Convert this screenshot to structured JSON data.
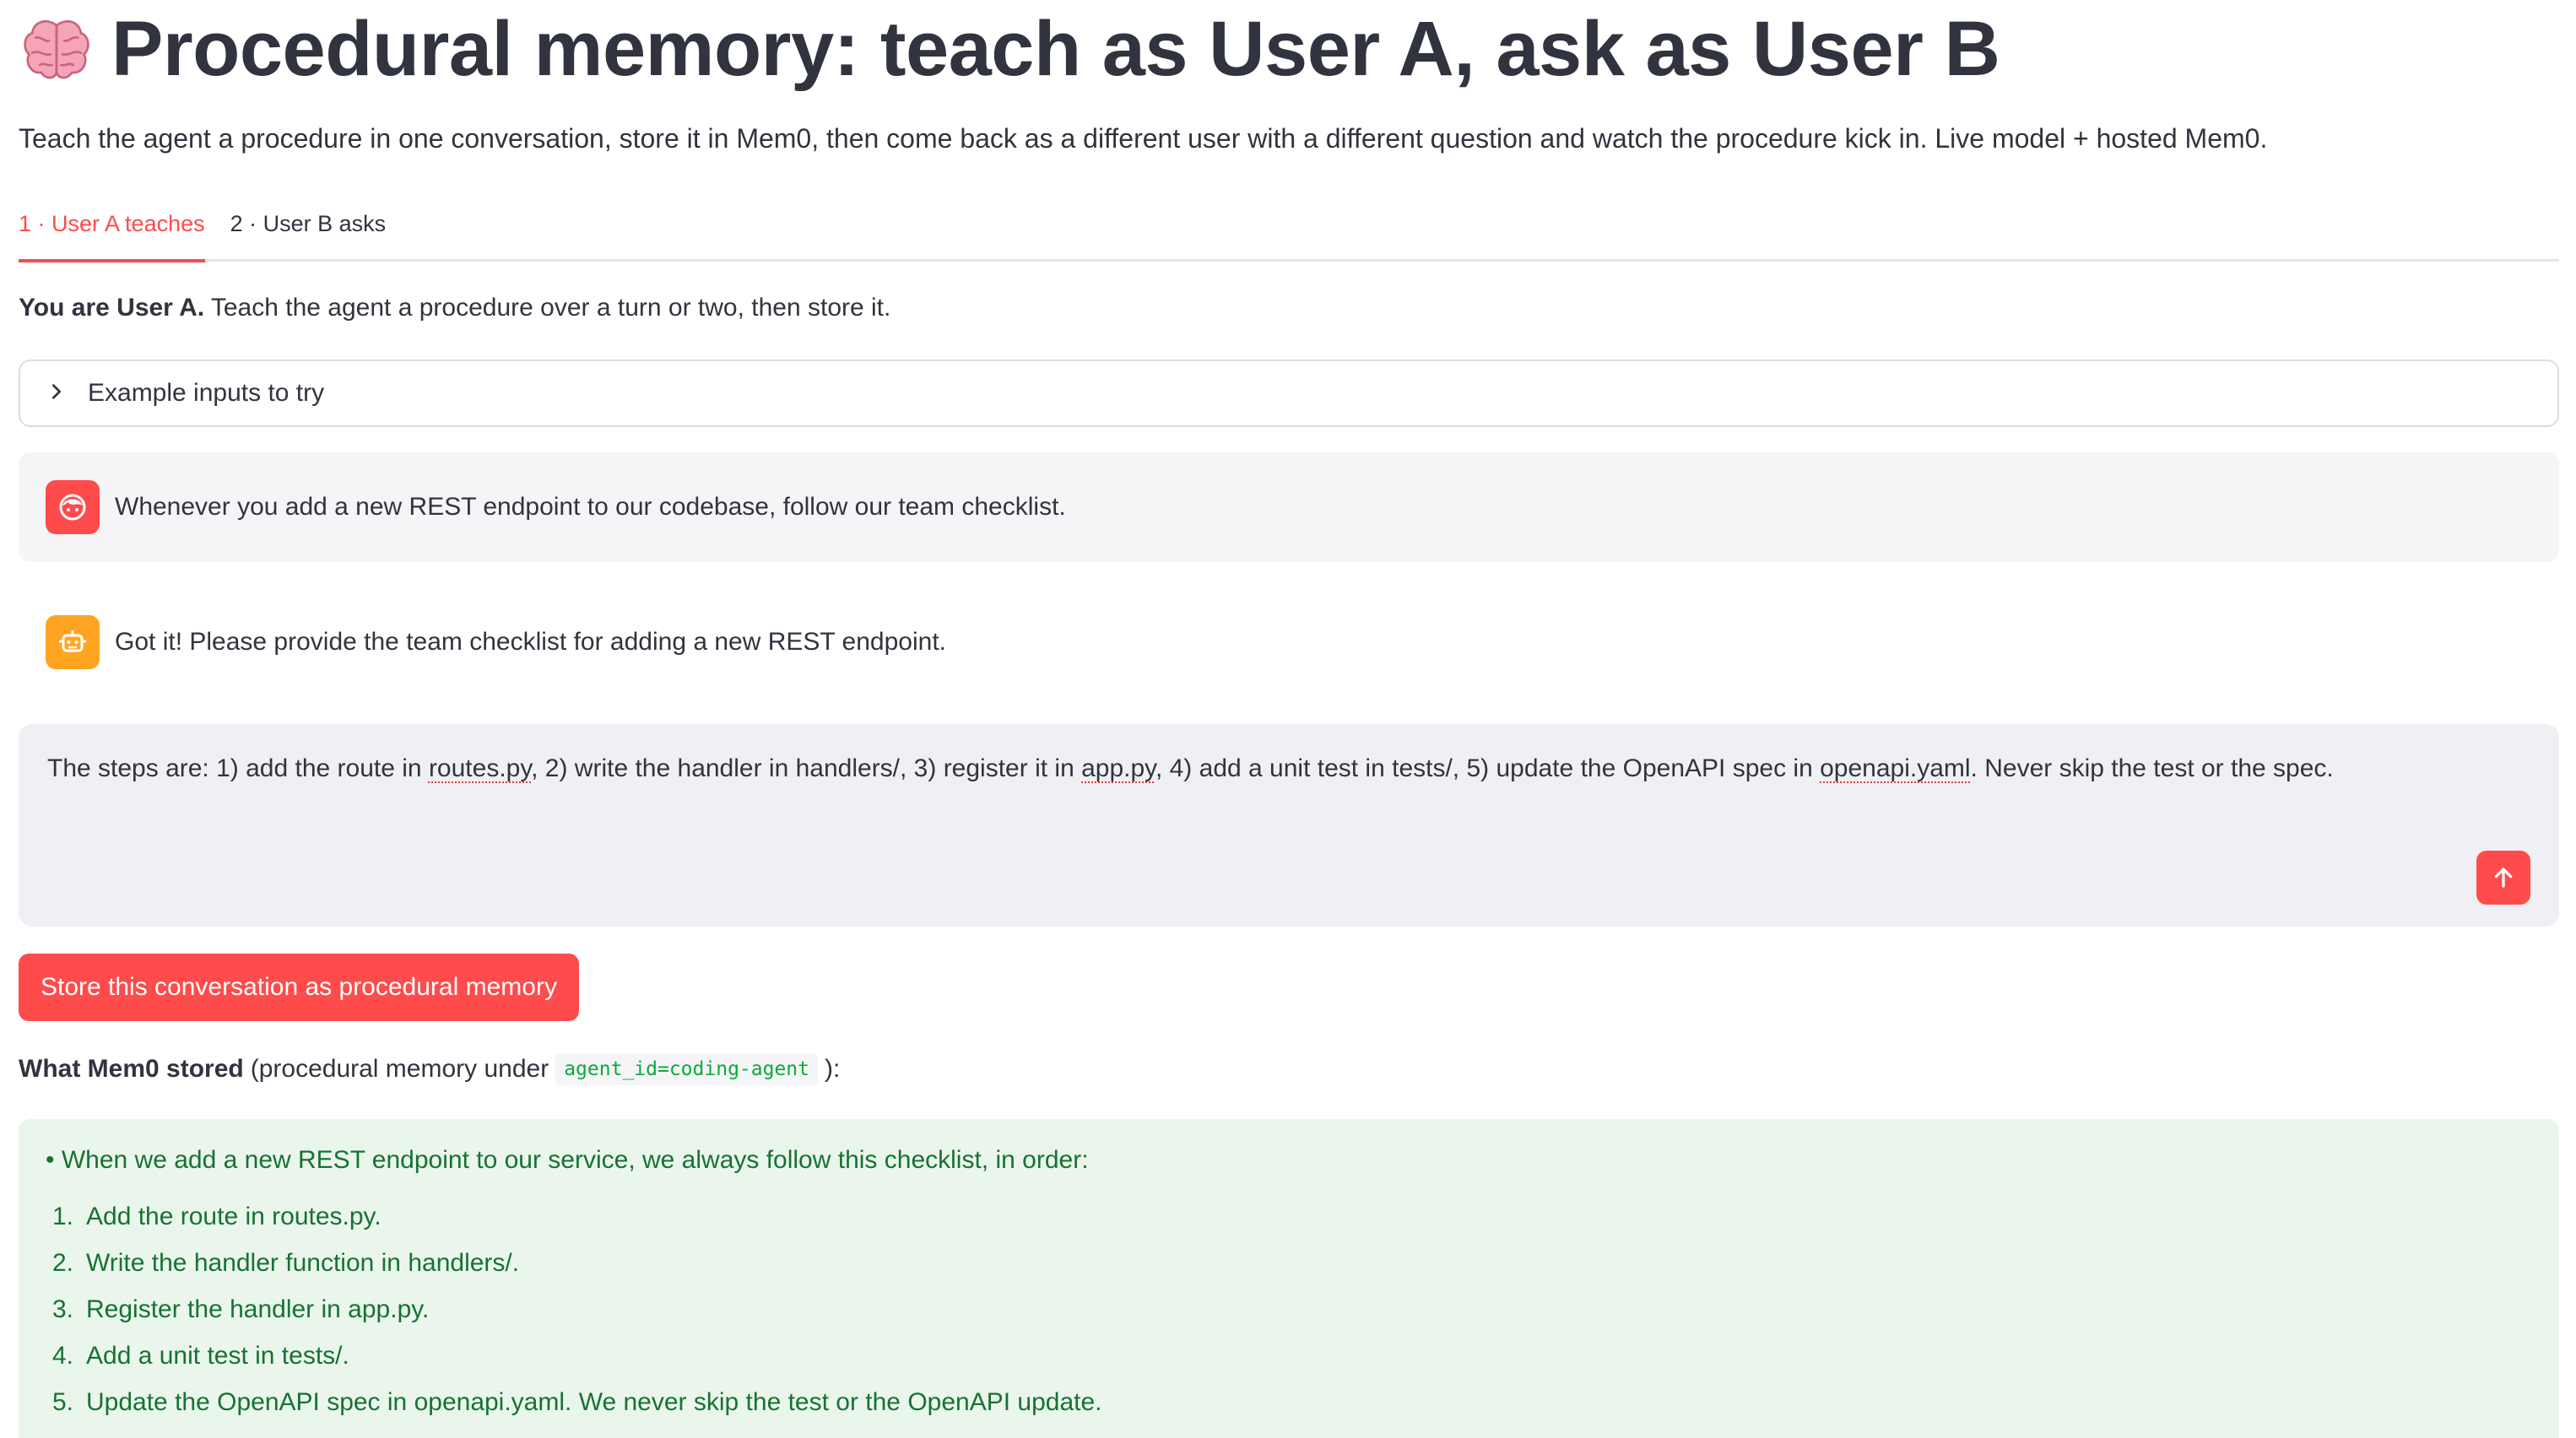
{
  "header": {
    "title": "Procedural memory: teach as User A, ask as User B",
    "title_icon": "brain-icon",
    "subtitle": "Teach the agent a procedure in one conversation, store it in Mem0, then come back as a different user with a different question and watch the procedure kick in. Live model + hosted Mem0."
  },
  "tabs": [
    {
      "label": "1 · User A teaches",
      "active": true
    },
    {
      "label": "2 · User B asks",
      "active": false
    }
  ],
  "intro": {
    "bold": "You are User A.",
    "rest": " Teach the agent a procedure over a turn or two, then store it."
  },
  "expander": {
    "label": "Example inputs to try"
  },
  "messages": [
    {
      "role": "user",
      "text": "Whenever you add a new REST endpoint to our codebase, follow our team checklist."
    },
    {
      "role": "assistant",
      "text": "Got it! Please provide the team checklist for adding a new REST endpoint."
    }
  ],
  "chat_input": {
    "parts": [
      "The steps are: 1) add the route in ",
      "routes.py",
      ", 2) write the handler in handlers/, 3) register it in ",
      "app.py",
      ", 4) add a unit test in tests/, 5) update the OpenAPI spec in ",
      "openapi.yaml",
      ". Never skip the test or the spec."
    ]
  },
  "store_button": {
    "label": "Store this conversation as procedural memory"
  },
  "stored": {
    "bold": "What Mem0 stored",
    "pre": "(procedural memory under",
    "code": "agent_id=coding-agent",
    "post": "):"
  },
  "memory": {
    "lead": "• When we add a new REST endpoint to our service, we always follow this checklist, in order:",
    "items": [
      {
        "num": "1.",
        "text": "Add the route in routes.py."
      },
      {
        "num": "2.",
        "text": "Write the handler function in handlers/."
      },
      {
        "num": "3.",
        "text": "Register the handler in app.py."
      },
      {
        "num": "4.",
        "text": "Add a unit test in tests/."
      },
      {
        "num": "5.",
        "text": "Update the OpenAPI spec in openapi.yaml. We never skip the test or the OpenAPI update."
      }
    ]
  },
  "colors": {
    "accent": "#ff4b4b",
    "bot_avatar": "#ffa421",
    "success_bg": "#eaf6ec",
    "success_text": "#177233",
    "code_text": "#09ab3b"
  }
}
